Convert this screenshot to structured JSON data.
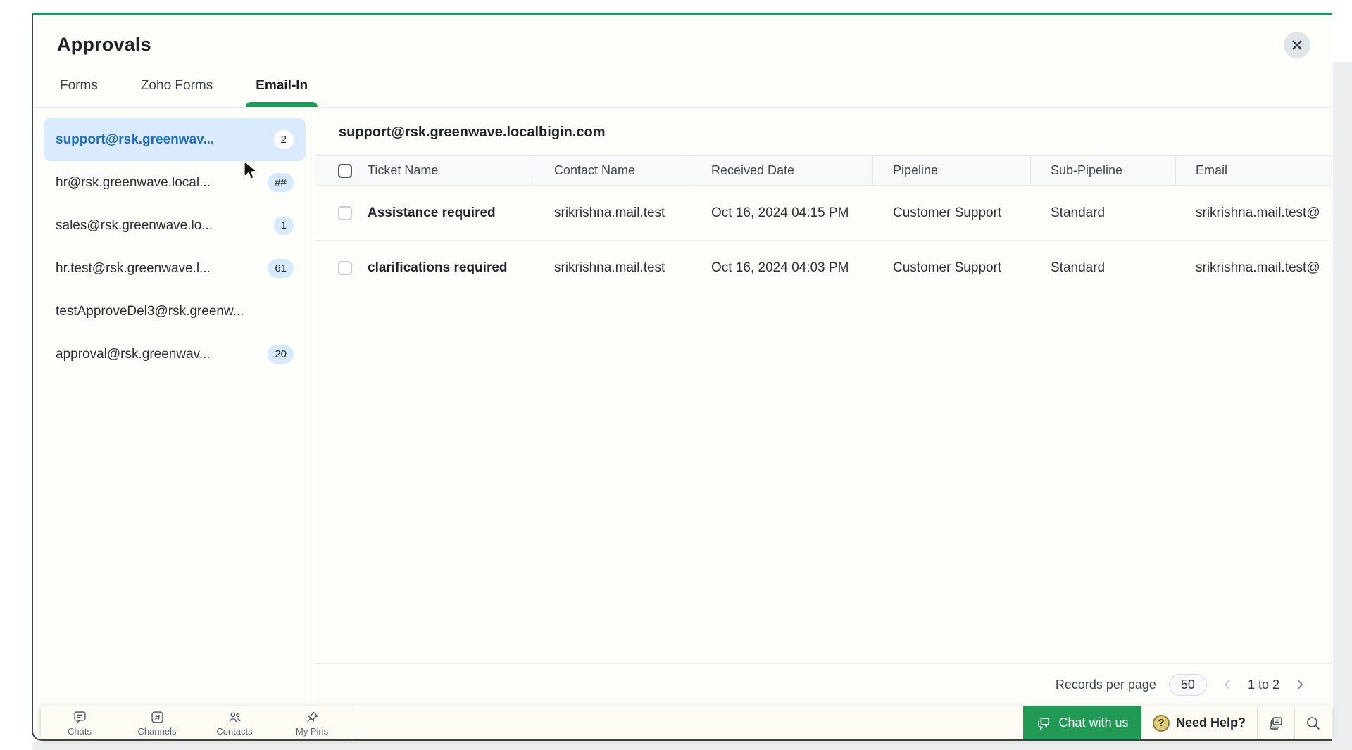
{
  "modal": {
    "title": "Approvals"
  },
  "tabs": [
    {
      "label": "Forms",
      "active": false
    },
    {
      "label": "Zoho Forms",
      "active": false
    },
    {
      "label": "Email-In",
      "active": true
    }
  ],
  "sidebar": {
    "items": [
      {
        "label": "support@rsk.greenwav...",
        "badge": "2",
        "selected": true
      },
      {
        "label": "hr@rsk.greenwave.local...",
        "badge": "##",
        "selected": false
      },
      {
        "label": "sales@rsk.greenwave.lo...",
        "badge": "1",
        "selected": false
      },
      {
        "label": "hr.test@rsk.greenwave.l...",
        "badge": "61",
        "selected": false
      },
      {
        "label": "testApproveDel3@rsk.greenw...",
        "badge": "",
        "selected": false
      },
      {
        "label": "approval@rsk.greenwav...",
        "badge": "20",
        "selected": false
      }
    ]
  },
  "main": {
    "title": "support@rsk.greenwave.localbigin.com",
    "table": {
      "columns": [
        "Ticket Name",
        "Contact Name",
        "Received Date",
        "Pipeline",
        "Sub-Pipeline",
        "Email"
      ],
      "rows": [
        {
          "ticket_name": "Assistance required",
          "contact_name": "srikrishna.mail.test",
          "received_date": "Oct 16, 2024 04:15 PM",
          "pipeline": "Customer Support",
          "sub_pipeline": "Standard",
          "email": "srikrishna.mail.test@"
        },
        {
          "ticket_name": "clarifications required",
          "contact_name": "srikrishna.mail.test",
          "received_date": "Oct 16, 2024 04:03 PM",
          "pipeline": "Customer Support",
          "sub_pipeline": "Standard",
          "email": "srikrishna.mail.test@"
        }
      ]
    },
    "pagination": {
      "label": "Records per page",
      "page_size": "50",
      "range": "1 to 2"
    }
  },
  "dock": {
    "items": [
      {
        "label": "Chats"
      },
      {
        "label": "Channels"
      },
      {
        "label": "Contacts"
      },
      {
        "label": "My Pins"
      }
    ],
    "chat_button": "Chat with us",
    "need_help": "Need Help?",
    "qmark": "?"
  },
  "colors": {
    "accent_green": "#17a05a",
    "chat_button_green": "#219a55",
    "selected_text_blue": "#1d6fc4",
    "selected_bg": "#d9ebfc",
    "badge_bg": "#d6eafc"
  }
}
